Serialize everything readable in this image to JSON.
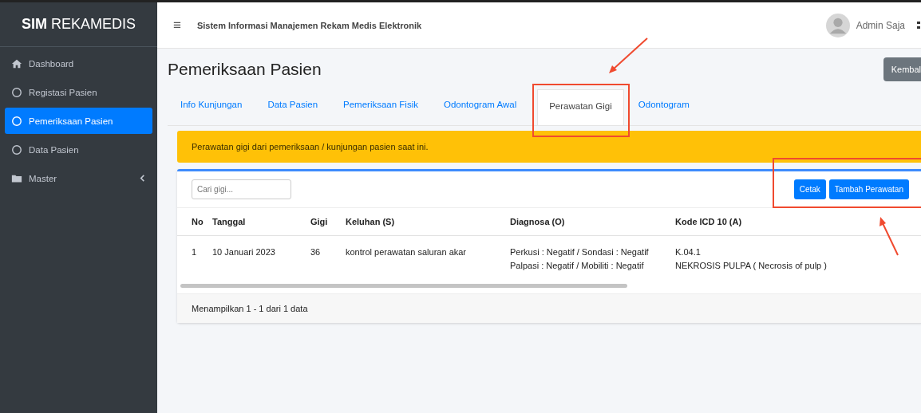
{
  "sidebar": {
    "brand_bold": "SIM",
    "brand": "REKAMEDIS",
    "items": [
      {
        "label": "Dashboard",
        "kind": "home",
        "selected": false
      },
      {
        "label": "Registasi Pasien",
        "kind": "page",
        "selected": false
      },
      {
        "label": "Pemeriksaan Pasien",
        "kind": "page",
        "selected": true
      },
      {
        "label": "Data Pasien",
        "kind": "page",
        "selected": false
      },
      {
        "label": "Master",
        "kind": "group",
        "selected": false,
        "expanded": false
      }
    ]
  },
  "navbar": {
    "menu_icon": "≡",
    "title": "Sistem Informasi Manajemen Rekam Medis Elektronik",
    "user": "Admin Saja"
  },
  "page": {
    "title": "Pemeriksaan Pasien",
    "back_button": "Kembal"
  },
  "tabs": [
    {
      "label": "Info Kunjungan",
      "selected": false
    },
    {
      "label": "Data Pasien",
      "selected": false
    },
    {
      "label": "Pemeriksaan Fisik",
      "selected": false
    },
    {
      "label": "Odontogram Awal",
      "selected": false
    },
    {
      "label": "Perawatan Gigi",
      "selected": true
    },
    {
      "label": "Odontogram",
      "selected": false
    }
  ],
  "alert": "Perawatan gigi dari pemeriksaan / kunjungan pasien saat ini.",
  "search": {
    "placeholder": "Cari gigi..."
  },
  "buttons": [
    "Cetak",
    "Tambah Perawatan"
  ],
  "table": {
    "columns": [
      "No",
      "Tanggal",
      "Gigi",
      "Keluhan (S)",
      "Diagnosa (O)",
      "Kode ICD 10 (A)"
    ],
    "rows": [
      {
        "no": "1",
        "tanggal": "10 Januari 2023",
        "gigi": "36",
        "keluhan": "kontrol perawatan saluran akar",
        "diagnosa": [
          "Perkusi : Negatif / Sondasi : Negatif",
          "Palpasi : Negatif / Mobiliti : Negatif"
        ],
        "kode": [
          "K.04.1",
          "NEKROSIS PULPA ( Necrosis of pulp )"
        ]
      }
    ]
  },
  "footer": "Menampilkan 1 - 1 dari 1 data"
}
